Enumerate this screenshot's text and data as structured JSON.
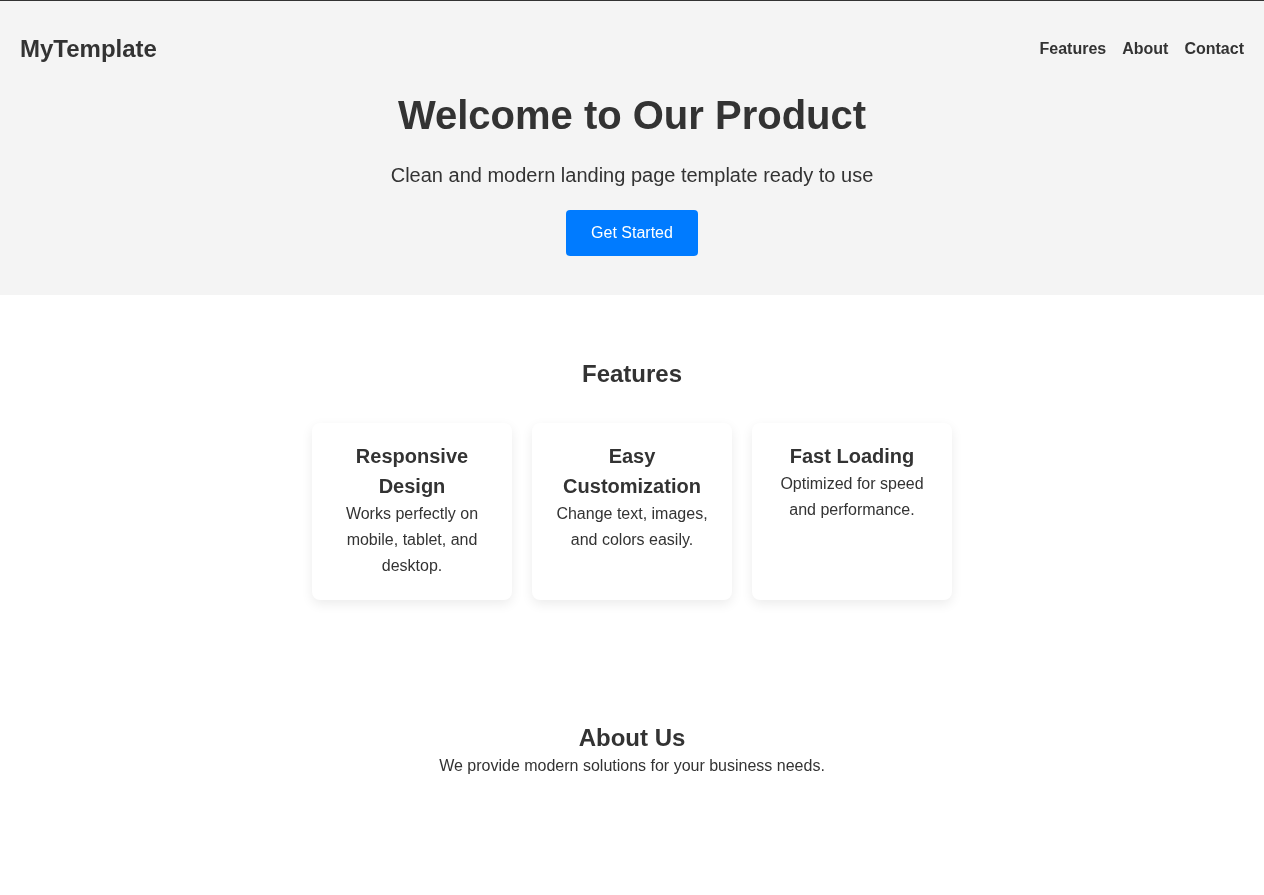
{
  "header": {
    "logo": "MyTemplate",
    "nav": [
      "Features",
      "About",
      "Contact"
    ]
  },
  "hero": {
    "title": "Welcome to Our Product",
    "subtitle": "Clean and modern landing page template ready to use",
    "button": "Get Started"
  },
  "features": {
    "heading": "Features",
    "cards": [
      {
        "title": "Responsive Design",
        "text": "Works perfectly on mobile, tablet, and desktop."
      },
      {
        "title": "Easy Customization",
        "text": "Change text, images, and colors easily."
      },
      {
        "title": "Fast Loading",
        "text": "Optimized for speed and performance."
      }
    ]
  },
  "about": {
    "heading": "About Us",
    "text": "We provide modern solutions for your business needs."
  }
}
